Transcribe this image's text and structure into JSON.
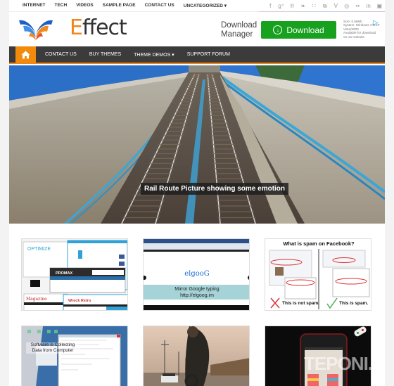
{
  "topbar": {
    "nav": [
      "INTERNET",
      "TECH",
      "VIDEOS",
      "SAMPLE PAGE",
      "CONTACT US",
      "UNCATEGORIZED ▾"
    ],
    "socials": [
      {
        "name": "facebook-icon",
        "glyph": "f"
      },
      {
        "name": "google-plus-icon",
        "glyph": "g⁺"
      },
      {
        "name": "pinterest-icon",
        "glyph": "℗"
      },
      {
        "name": "twitter-icon",
        "glyph": "❧"
      },
      {
        "name": "rss-icon",
        "glyph": "∷"
      },
      {
        "name": "instagram-icon",
        "glyph": "⧉"
      },
      {
        "name": "vimeo-icon",
        "glyph": "V"
      },
      {
        "name": "dribbble-icon",
        "glyph": "◎"
      },
      {
        "name": "flickr-icon",
        "glyph": "••"
      },
      {
        "name": "linkedin-icon",
        "glyph": "in"
      },
      {
        "name": "youtube-icon",
        "glyph": "▣"
      }
    ]
  },
  "header": {
    "logo_first": "E",
    "logo_rest": "ffect",
    "ad": {
      "title_line1": "Download",
      "title_line2": "Manager",
      "button_label": "Download",
      "button_icon": "↓",
      "info": [
        "Size: 0.66Mb",
        "System: Windows 7/8/XP",
        "Vista/2000",
        "Available for download",
        "on our website"
      ],
      "choice_icon": "▷"
    }
  },
  "mainnav": {
    "home_icon": "⌂",
    "items": [
      "CONTACT US",
      "BUY THEMES",
      "THEME DEMOS ▾",
      "SUPPORT FORUM"
    ]
  },
  "hero": {
    "caption": "Rail Route Picture showing some emotion"
  },
  "posts": [
    {
      "name": "post-thumb-themes",
      "label": "OPTIMIZE / PROMAX / Magazine / Wreck Retro"
    },
    {
      "name": "post-thumb-mirror-google",
      "line1": "Mirror Google typing",
      "line2": "http://elgoog.im",
      "logo": "elgooG"
    },
    {
      "name": "post-thumb-facebook-spam",
      "title": "What is spam on Facebook?",
      "left": "This is not spam.",
      "right": "This is spam."
    },
    {
      "name": "post-thumb-software",
      "label": "Software is Collecting Data from Computer"
    },
    {
      "name": "post-thumb-game",
      "label": ""
    },
    {
      "name": "post-thumb-phone",
      "label": "TEPONI.R"
    }
  ]
}
